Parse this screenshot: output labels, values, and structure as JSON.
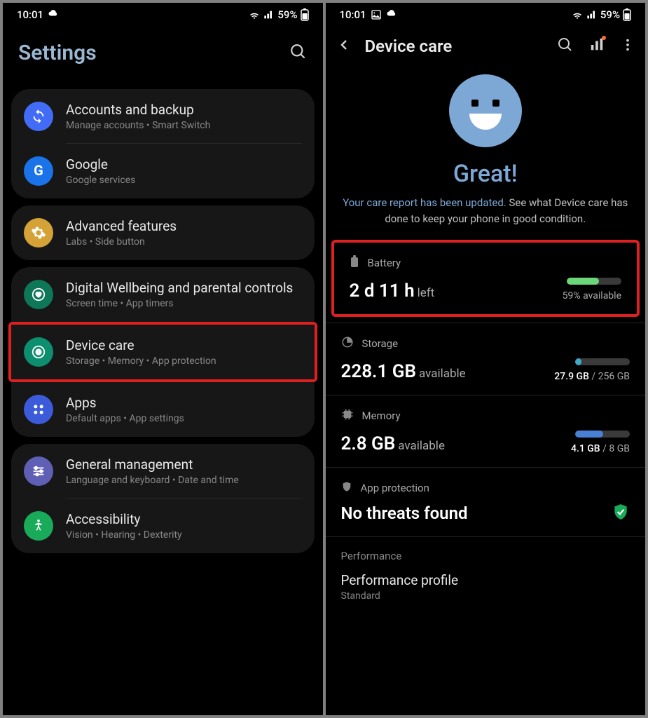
{
  "status": {
    "time": "10:01",
    "battery": "59%"
  },
  "left": {
    "title": "Settings",
    "groups": [
      {
        "items": [
          {
            "icon": "sync",
            "bg": "bg-blue",
            "title": "Accounts and backup",
            "subtitle": "Manage accounts  •  Smart Switch"
          },
          {
            "icon": "google",
            "bg": "bg-google",
            "title": "Google",
            "subtitle": "Google services"
          }
        ]
      },
      {
        "items": [
          {
            "icon": "gear",
            "bg": "bg-yellow",
            "title": "Advanced features",
            "subtitle": "Labs  •  Side button"
          }
        ]
      },
      {
        "items": [
          {
            "icon": "heart",
            "bg": "bg-green",
            "title": "Digital Wellbeing and parental controls",
            "subtitle": "Screen time  •  App timers"
          },
          {
            "icon": "device-care",
            "bg": "bg-teal",
            "title": "Device care",
            "subtitle": "Storage  •  Memory  •  App protection",
            "highlight": true
          },
          {
            "icon": "apps",
            "bg": "bg-blue2",
            "title": "Apps",
            "subtitle": "Default apps  •  App settings"
          }
        ]
      },
      {
        "items": [
          {
            "icon": "sliders",
            "bg": "bg-purple",
            "title": "General management",
            "subtitle": "Language and keyboard  •  Date and time"
          },
          {
            "icon": "accessibility",
            "bg": "bg-green2",
            "title": "Accessibility",
            "subtitle": "Vision  •  Hearing  •  Dexterity"
          }
        ]
      }
    ]
  },
  "right": {
    "title": "Device care",
    "heroTitle": "Great!",
    "heroLink": "Your care report has been updated.",
    "heroText": " See what Device care has done to keep your phone in good condition.",
    "battery": {
      "label": "Battery",
      "main": "2 d 11 h",
      "sub": "left",
      "percent": "59% available",
      "fill": 59,
      "color": "#6bd67a"
    },
    "storage": {
      "label": "Storage",
      "main": "228.1 GB",
      "sub": "available",
      "used": "27.9 GB",
      "total": "256 GB",
      "fill": 11,
      "color": "#3fa9c9"
    },
    "memory": {
      "label": "Memory",
      "main": "2.8 GB",
      "sub": "available",
      "used": "4.1 GB",
      "total": "8 GB",
      "fill": 51,
      "color": "#4a7fd6"
    },
    "appProtection": {
      "label": "App protection",
      "status": "No threats found"
    },
    "performance": {
      "section": "Performance",
      "title": "Performance profile",
      "sub": "Standard"
    }
  }
}
